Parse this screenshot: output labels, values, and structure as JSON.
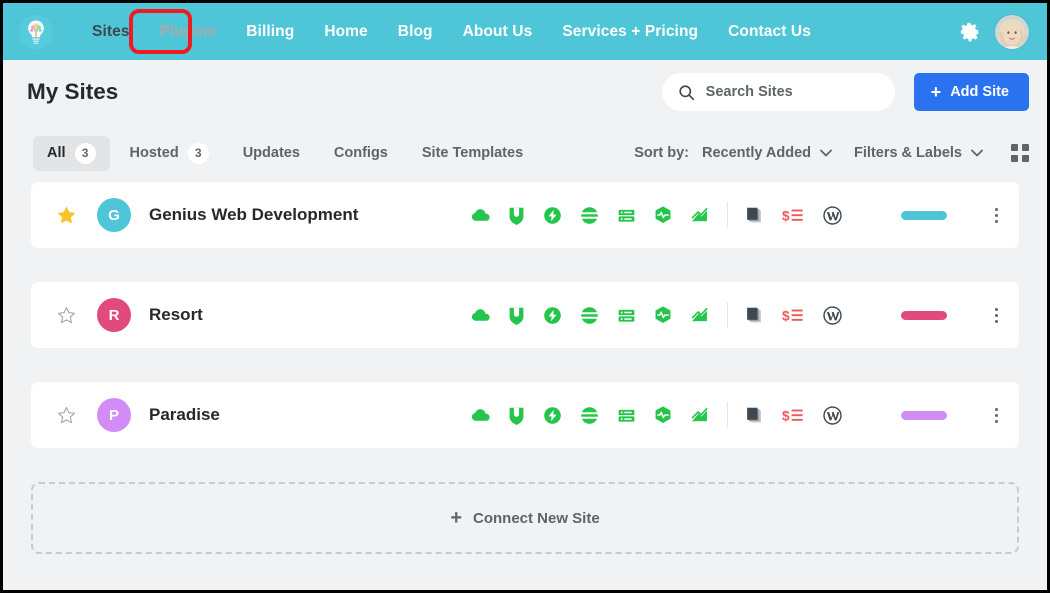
{
  "header": {
    "logo_icon": "lightbulb-logo",
    "brand_color": "#4fc6d8",
    "nav": [
      {
        "label": "Sites",
        "state": "active"
      },
      {
        "label": "Plugins",
        "state": "muted"
      },
      {
        "label": "Billing",
        "state": "normal"
      },
      {
        "label": "Home",
        "state": "normal"
      },
      {
        "label": "Blog",
        "state": "normal"
      },
      {
        "label": "About Us",
        "state": "normal"
      },
      {
        "label": "Services + Pricing",
        "state": "normal"
      },
      {
        "label": "Contact Us",
        "state": "normal"
      }
    ],
    "gear_icon": "gear-icon",
    "avatar_icon": "user-avatar-photo",
    "annotation_color": "#ee1c22",
    "annotation_target": "Sites"
  },
  "page": {
    "title": "My Sites",
    "search": {
      "placeholder": "Search Sites",
      "value": "",
      "icon": "search-icon"
    },
    "add_site": {
      "label": "Add Site",
      "icon": "plus-icon",
      "color": "#2a72f0"
    }
  },
  "filters": {
    "tabs": [
      {
        "label": "All",
        "count": "3",
        "active": true
      },
      {
        "label": "Hosted",
        "count": "3",
        "active": false
      },
      {
        "label": "Updates",
        "count": null,
        "active": false
      },
      {
        "label": "Configs",
        "count": null,
        "active": false
      },
      {
        "label": "Site Templates",
        "count": null,
        "active": false
      }
    ],
    "sort_label": "Sort by:",
    "sort_value": "Recently Added",
    "filters_label": "Filters & Labels",
    "view_toggle_icon": "grid-view-icon"
  },
  "sites": [
    {
      "name": "Genius Web Development",
      "initial": "G",
      "avatar_color": "#4fc6d8",
      "favorite": true,
      "label_color": "#4fc6d8"
    },
    {
      "name": "Resort",
      "initial": "R",
      "avatar_color": "#e14a7d",
      "favorite": false,
      "label_color": "#e14a7d"
    },
    {
      "name": "Paradise",
      "initial": "P",
      "avatar_color": "#d18cf5",
      "favorite": false,
      "label_color": "#d18cf5"
    }
  ],
  "row_icons": {
    "status_color": "#25c44a",
    "status": [
      "cloud-icon",
      "shield-hub-icon",
      "hummingbird-bolt-icon",
      "smartcrawl-icon",
      "server-stack-icon",
      "hexagon-pulse-icon",
      "analytics-chart-icon"
    ],
    "meta": [
      {
        "name": "stacked-pages-icon",
        "color": "#3d4850"
      },
      {
        "name": "billing-dollar-list-icon",
        "color": "#f05a5a"
      },
      {
        "name": "wordpress-icon",
        "color": "#3d4850"
      }
    ],
    "kebab_icon": "more-options-icon"
  },
  "connect": {
    "label": "Connect New Site",
    "icon": "plus-icon"
  }
}
